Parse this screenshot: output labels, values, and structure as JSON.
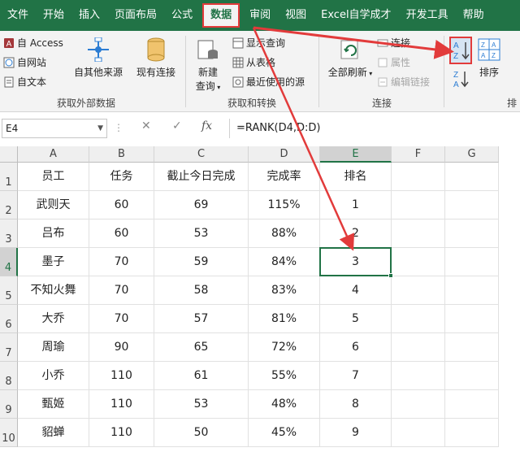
{
  "menu": {
    "items": [
      "文件",
      "开始",
      "插入",
      "页面布局",
      "公式",
      "数据",
      "审阅",
      "视图",
      "Excel自学成才",
      "开发工具",
      "帮助"
    ],
    "active_index": 5
  },
  "ribbon": {
    "external": {
      "access": "自 Access",
      "web": "自网站",
      "text": "自文本",
      "other": "自其他来源",
      "existing": "现有连接",
      "group_label": "获取外部数据"
    },
    "transform": {
      "new_query": "新建",
      "new_query_sub": "查询",
      "show_query": "显示查询",
      "from_table": "从表格",
      "recent": "最近使用的源",
      "group_label": "获取和转换"
    },
    "connections": {
      "refresh_all": "全部刷新",
      "connections": "连接",
      "properties": "属性",
      "edit_links": "编辑链接",
      "group_label": "连接"
    },
    "sort": {
      "sort_label": "排序",
      "group_label_partial": "排"
    }
  },
  "formula_bar": {
    "name_box": "E4",
    "formula": "=RANK(D4,D:D)",
    "cancel_icon": "✕",
    "enter_icon": "✓",
    "fx": "fx"
  },
  "sheet": {
    "columns": [
      "A",
      "B",
      "C",
      "D",
      "E",
      "F",
      "G"
    ],
    "rows": [
      "1",
      "2",
      "3",
      "4",
      "5",
      "6",
      "7",
      "8",
      "9",
      "10"
    ],
    "selected_col": "E",
    "selected_row": "4",
    "cells": [
      [
        "员工",
        "任务",
        "截止今日完成",
        "完成率",
        "排名"
      ],
      [
        "武则天",
        "60",
        "69",
        "115%",
        "1"
      ],
      [
        "吕布",
        "60",
        "53",
        "88%",
        "2"
      ],
      [
        "墨子",
        "70",
        "59",
        "84%",
        "3"
      ],
      [
        "不知火舞",
        "70",
        "58",
        "83%",
        "4"
      ],
      [
        "大乔",
        "70",
        "57",
        "81%",
        "5"
      ],
      [
        "周瑜",
        "90",
        "65",
        "72%",
        "6"
      ],
      [
        "小乔",
        "110",
        "61",
        "55%",
        "7"
      ],
      [
        "甄姬",
        "110",
        "53",
        "48%",
        "8"
      ],
      [
        "貂蝉",
        "110",
        "50",
        "45%",
        "9"
      ]
    ]
  },
  "colors": {
    "excel_green": "#217346",
    "annotation_red": "#e23b3b"
  }
}
